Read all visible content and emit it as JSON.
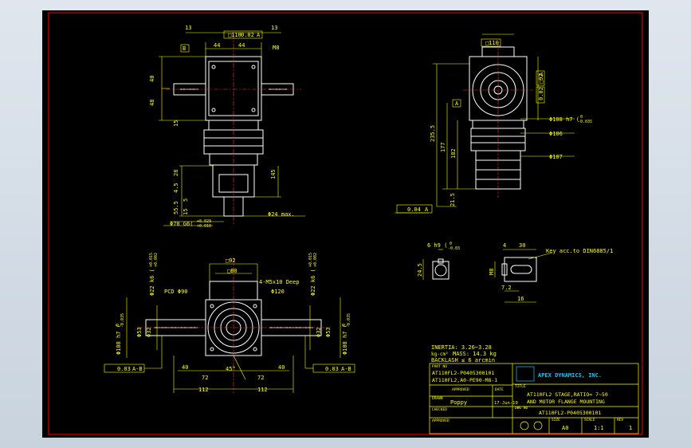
{
  "drawing": {
    "top_left_view": {
      "labels": {
        "d13a": "13",
        "sq110": "□110",
        "tol_002a": "0.02",
        "datum_a": "A",
        "d13b": "13",
        "datum_b": "B",
        "d44a": "44",
        "d44b": "44",
        "m8": "M8",
        "d40": "40",
        "d48": "48",
        "d15": "15",
        "d28": "28",
        "d145": "145",
        "d45": "4.5",
        "d5": "5",
        "d555": "55.5",
        "d15b": "15",
        "phi24": "Φ24 max.",
        "phi70": "Φ70 G6(",
        "fit_top": "+0.029",
        "fit_bot": "+0.010"
      }
    },
    "top_right_view": {
      "labels": {
        "sq110": "□110",
        "sq92": "□92",
        "datum_a": "A",
        "tol_002": "0.02",
        "phi108": "Φ108 h7 (",
        "phi108_fit_top": "0",
        "phi108_fit_bot": "-0.035",
        "phi106": "Φ106",
        "phi107": "Φ107",
        "d2355": "235.5",
        "d177": "177",
        "d182": "182",
        "d215": "21.5",
        "tol_004": "0.04",
        "datum_a2": "A"
      }
    },
    "bottom_left_view": {
      "labels": {
        "sq92": "□92",
        "sq80": "□80",
        "m5": "4-M5x10 Deep",
        "phi120": "Φ120",
        "pcd": "PCD Φ90",
        "phi22a": "Φ22 k6 (",
        "phi22b": "Φ22 k6 (",
        "fit22_top": "+0.015",
        "fit22_bot": "+0.002",
        "phi53a": "Φ53",
        "phi53b": "Φ53",
        "phi108a": "Φ108 h7 (",
        "phi108b": "Φ108 h7 (",
        "fit108_top": "0",
        "fit108_bot": "-0.035",
        "phi32a": "Φ32",
        "phi32b": "Φ32",
        "tol_003a": "0.03",
        "ab_a": "A-B",
        "tol_003b": "0.03",
        "ab_b": "A-B",
        "d40a": "40",
        "d40b": "40",
        "d72a": "72",
        "d72b": "72",
        "d45deg": "45°",
        "d112a": "112",
        "d112b": "112"
      }
    },
    "key_views": {
      "labels": {
        "d6": "6 h9 (",
        "fit6_top": "0",
        "fit6_bot": "-0.03",
        "d245": "24.5",
        "d4": "4",
        "d30": "30",
        "d22": "22",
        "d72": "7.2",
        "d16": "16",
        "m8": "M8",
        "key_note": "Key acc.to DIN6885/1"
      }
    }
  },
  "notes": {
    "inertia": "INERTIA: 3.26~3.28",
    "kg_cm2": "kg-cm²",
    "mass": "MASS: 14.3 kg",
    "backlash": "BACKLASH ≤ 6 arcmin"
  },
  "title_block": {
    "part_no_label": "PART NO",
    "part_no_1": "AT110FL2-P0405300101",
    "part_no_2": "AT110FL2,A0-PE90-M8-1",
    "approved_label": "APPROVED",
    "date_label": "DATE",
    "title_label": "TITLE",
    "drawn_label": "DRAWN",
    "drawn_by": "Poppy",
    "drawn_date": "17-Jun-19",
    "dwg_label": "DWG NO",
    "checked_label": "CHECKED",
    "dwg_no": "AT110FL2-P0405300101",
    "approved2_label": "APPROVED",
    "size_label": "SIZE",
    "size": "A0",
    "scale_label": "SCALE",
    "scale": "1:1",
    "rev_label": "REV",
    "rev": "1",
    "company": "APEX DYNAMICS, INC.",
    "title_1": "AT110FL2 STAGE,RATIO= 7~50",
    "title_2": "AND MOTOR FLANGE MOUNTING"
  },
  "colors": {
    "geometry": "#ffffff",
    "dimension": "#ffff00",
    "border": "#ff0000",
    "titleblock": "#ffff00",
    "center": "#ff3333",
    "canvas": "#000000"
  }
}
